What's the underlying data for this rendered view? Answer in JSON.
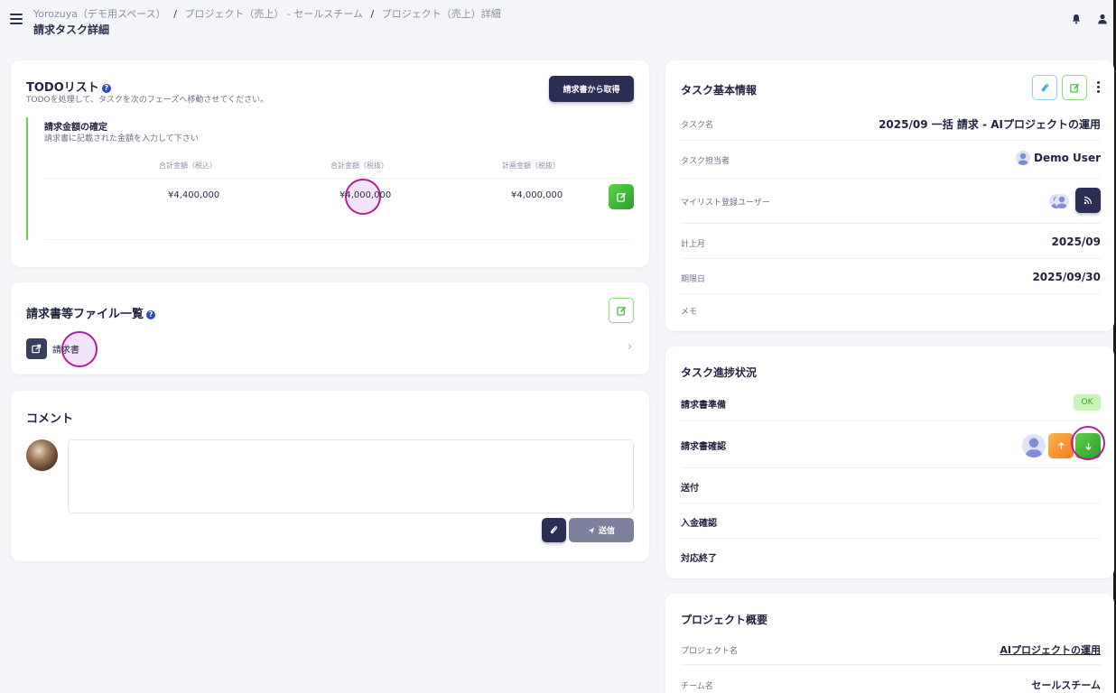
{
  "header": {
    "breadcrumb": [
      "Yorozuya（デモ用スペース）",
      "プロジェクト（売上） - セールスチーム",
      "プロジェクト（売上）詳細"
    ],
    "separator": "/",
    "title": "請求タスク詳細"
  },
  "todo": {
    "title": "TODOリスト",
    "help": "?",
    "subtitle": "TODOを処理して、タスクを次のフェーズへ移動させてください。",
    "fetch_button": "請求書から取得",
    "item_title": "請求金額の確定",
    "item_desc": "請求書に記載された金額を入力して下さい",
    "columns": [
      "合計金額（税込）",
      "合計金額（税抜）",
      "計画金額（税抜）"
    ],
    "values": [
      "¥4,400,000",
      "¥4,000,000",
      "¥4,000,000"
    ]
  },
  "files": {
    "title": "請求書等ファイル一覧",
    "help": "?",
    "item_label": "請求書",
    "chevron": "›"
  },
  "comment": {
    "title": "コメント",
    "placeholder": "",
    "send_label": "送信"
  },
  "task_info": {
    "title": "タスク基本情報",
    "rows": [
      {
        "label": "タスク名",
        "value": "2025/09 一括 請求 - AIプロジェクトの運用"
      },
      {
        "label": "タスク担当者",
        "value": "Demo User"
      },
      {
        "label": "マイリスト登録ユーザー",
        "value": ""
      },
      {
        "label": "計上月",
        "value": "2025/09"
      },
      {
        "label": "期限日",
        "value": "2025/09/30"
      },
      {
        "label": "メモ",
        "value": ""
      }
    ]
  },
  "progress": {
    "title": "タスク進捗状況",
    "steps": [
      {
        "label": "請求書準備",
        "badge": "OK"
      },
      {
        "label": "請求書確認"
      },
      {
        "label": "送付"
      },
      {
        "label": "入金確認"
      },
      {
        "label": "対応終了"
      }
    ]
  },
  "project": {
    "title": "プロジェクト概要",
    "rows": [
      {
        "label": "プロジェクト名",
        "value": "AIプロジェクトの運用"
      },
      {
        "label": "チーム名",
        "value": "セールスチーム"
      }
    ]
  },
  "colors": {
    "accent_dark": "#2c2f55",
    "accent_green": "#3db835",
    "accent_orange": "#f49a2c",
    "highlight": "#b51e9a"
  }
}
